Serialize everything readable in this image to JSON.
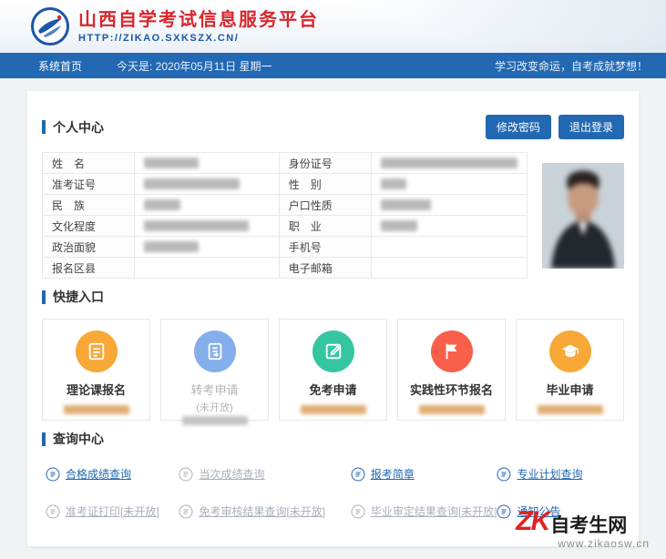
{
  "header": {
    "title": "山西自学考试信息服务平台",
    "url": "HTTP://ZIKAO.SXKSZX.CN/",
    "brand_color": "#d9262c",
    "accent_color": "#2268b2"
  },
  "navbar": {
    "home_label": "系统首页",
    "today_label": "今天是: 2020年05月11日  星期一",
    "slogan": "学习改变命运，自考成就梦想！"
  },
  "personal": {
    "title": "个人中心",
    "change_password_label": "修改密码",
    "logout_label": "退出登录",
    "rows": [
      {
        "l1": "姓　名",
        "l2": "身份证号"
      },
      {
        "l1": "准考证号",
        "l2": "性　别"
      },
      {
        "l1": "民　族",
        "l2": "户口性质"
      },
      {
        "l1": "文化程度",
        "l2": "职　业"
      },
      {
        "l1": "政治面貌",
        "l2": "手机号"
      },
      {
        "l1": "报名区县",
        "l2": "电子邮箱"
      }
    ]
  },
  "quick": {
    "title": "快捷入口",
    "cards": [
      {
        "label": "理论课报名",
        "sub": "",
        "color": "#f7a836"
      },
      {
        "label": "转考申请",
        "sub": "(未开放)",
        "color": "#85aeec"
      },
      {
        "label": "免考申请",
        "sub": "",
        "color": "#35c6a1"
      },
      {
        "label": "实践性环节报名",
        "sub": "",
        "color": "#f9604b"
      },
      {
        "label": "毕业申请",
        "sub": "",
        "color": "#f7a836"
      }
    ]
  },
  "query": {
    "title": "查询中心",
    "links": [
      {
        "label": "合格成绩查询"
      },
      {
        "label": "当次成绩查询"
      },
      {
        "label": "报考简章"
      },
      {
        "label": "专业计划查询"
      },
      {
        "label": "准考证打印[未开放]"
      },
      {
        "label": "免考审核结果查询[未开放]"
      },
      {
        "label": "毕业审定结果查询[未开放]"
      },
      {
        "label": "通知公告"
      }
    ]
  },
  "watermark": {
    "logo_text": "ZK",
    "site_name": "自考生网",
    "site_url": "www.zikaosw.cn"
  }
}
